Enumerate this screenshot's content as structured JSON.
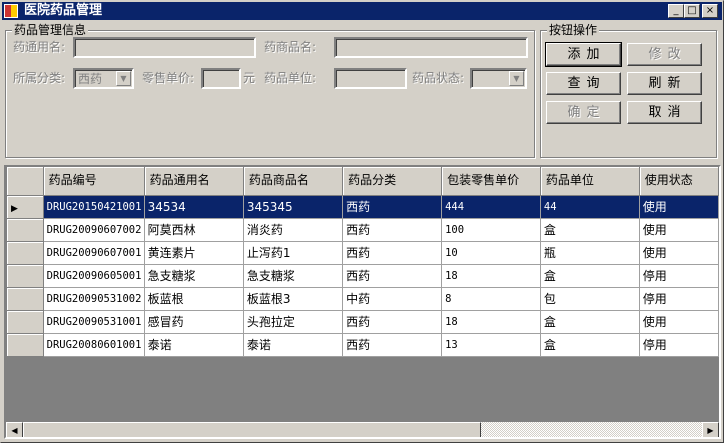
{
  "window": {
    "title": "医院药品管理",
    "minimize": "_",
    "maximize": "□",
    "close": "×"
  },
  "info_group": {
    "legend": "药品管理信息",
    "generic_name_label": "药通用名:",
    "generic_name_value": "",
    "trade_name_label": "药商品名:",
    "trade_name_value": "",
    "category_label": "所属分类:",
    "category_value": "西药",
    "retail_price_label": "零售单价:",
    "retail_price_value": "",
    "currency_unit": "元",
    "unit_label": "药品单位:",
    "unit_value": "",
    "status_label": "药品状态:",
    "status_value": ""
  },
  "button_group": {
    "legend": "按钮操作",
    "add": "添加",
    "edit": "修改",
    "query": "查询",
    "refresh": "刷新",
    "confirm": "确定",
    "cancel": "取消"
  },
  "grid": {
    "columns": [
      "药品编号",
      "药品通用名",
      "药品商品名",
      "药品分类",
      "包装零售单价",
      "药品单位",
      "使用状态"
    ],
    "rows": [
      [
        "DRUG20150421001",
        "34534",
        "345345",
        "西药",
        "444",
        "44",
        "使用"
      ],
      [
        "DRUG20090607002",
        "阿莫西林",
        "消炎药",
        "西药",
        "100",
        "盒",
        "使用"
      ],
      [
        "DRUG20090607001",
        "黄连素片",
        "止泻药1",
        "西药",
        "10",
        "瓶",
        "使用"
      ],
      [
        "DRUG20090605001",
        "急支糖浆",
        "急支糖浆",
        "西药",
        "18",
        "盒",
        "停用"
      ],
      [
        "DRUG20090531002",
        "板蓝根",
        "板蓝根3",
        "中药",
        "8",
        "包",
        "停用"
      ],
      [
        "DRUG20090531001",
        "感冒药",
        "头孢拉定",
        "西药",
        "18",
        "盒",
        "使用"
      ],
      [
        "DRUG20080601001",
        "泰诺",
        "泰诺",
        "西药",
        "13",
        "盒",
        "停用"
      ]
    ],
    "selected_row": 0
  }
}
